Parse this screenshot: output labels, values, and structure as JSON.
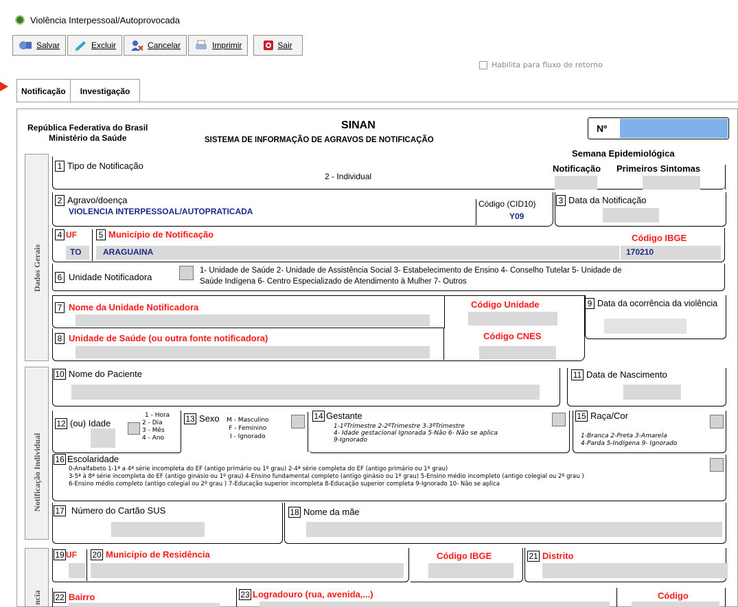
{
  "window": {
    "title": "Violência Interpessoal/Autoprovocada"
  },
  "toolbar": {
    "save": "Salvar",
    "delete": "Excluir",
    "cancel": "Cancelar",
    "print": "Imprimir",
    "exit": "Sair"
  },
  "habilita": "Habilita para fluxo de retorno",
  "tabs": [
    "Notificação",
    "Investigação"
  ],
  "header": {
    "republica": "República Federativa do Brasil",
    "ministerio": "Ministério da Saúde",
    "sinan": "SINAN",
    "sistema": "SISTEMA DE INFORMAÇÃO  DE AGRAVOS DE NOTIFICAÇÃO",
    "numero": "Nº"
  },
  "sections": {
    "gerais": "Dados Gerais",
    "individual": "Notificação Individual",
    "residencia": "ncia"
  },
  "f1": {
    "num": "1",
    "label": "Tipo de Notificação",
    "value": "2 - Individual",
    "semana": "Semana Epidemiológica",
    "notif": "Notificação",
    "sintomas": "Primeiros Sintomas"
  },
  "f2": {
    "num": "2",
    "label": "Agravo/doença",
    "value": "VIOLENCIA INTERPESSOAL/AUTOPRATICADA",
    "cid_label": "Código (CID10)",
    "cid": "Y09"
  },
  "f3": {
    "num": "3",
    "label": "Data da Notificação"
  },
  "f4": {
    "num": "4",
    "label": "UF",
    "value": "TO"
  },
  "f5": {
    "num": "5",
    "label": "Município de Notificação",
    "value": "ARAGUAINA",
    "ibge_label": "Código IBGE",
    "ibge": "170210"
  },
  "f6": {
    "num": "6",
    "label": "Unidade Notificadora",
    "options1": "1- Unidade de Saúde   2- Unidade de Assistência Social  3- Estabelecimento de Ensino  4- Conselho Tutelar  5- Unidade de",
    "options2": "Saúde Indígena  6- Centro Especializado de Atendimento à Mulher  7- Outros"
  },
  "f7": {
    "num": "7",
    "label": "Nome da Unidade Notificadora",
    "cod": "Código Unidade"
  },
  "f8": {
    "num": "8",
    "label": "Unidade de Saúde (ou outra fonte notificadora)",
    "cod": "Código CNES"
  },
  "f9": {
    "num": "9",
    "label": "Data da ocorrência da violência"
  },
  "f10": {
    "num": "10",
    "label": "Nome do Paciente"
  },
  "f11": {
    "num": "11",
    "label": "Data de Nascimento"
  },
  "f12": {
    "num": "12",
    "label": "(ou) Idade",
    "o1": "1 - Hora",
    "o2": "2 - Dia",
    "o3": "3 - Mês",
    "o4": "4 - Ano"
  },
  "f13": {
    "num": "13",
    "label": "Sexo",
    "o1": "M - Masculino",
    "o2": "F - Feminino",
    "o3": "I - Ignorado"
  },
  "f14": {
    "num": "14",
    "label": "Gestante",
    "l1": "1-1ºTrimestre   2-2ºTrimestre        3-3ºTrimestre",
    "l2": "4- Idade gestacional Ignorada   5-Não      6- Não se aplica",
    "l3": "9-Ignorado"
  },
  "f15": {
    "num": "15",
    "label": "Raça/Cor",
    "l1": "1-Branca     2-Preta          3-Amarela",
    "l2": "4-Parda       5-Indígena     9- Ignorado"
  },
  "f16": {
    "num": "16",
    "label": "Escolaridade",
    "l1": "0-Analfabeto    1-1ª a 4ª série incompleta do EF (antigo primário ou 1º grau)    2-4ª série completa do EF (antigo primário ou 1º grau)",
    "l2": "3-5ª à 8ª série incompleta do EF (antigo ginásio ou 1º grau)    4-Ensino fundamental completo (antigo ginásio ou 1º grau)     5-Ensino médio incompleto (antigo colegial  ou 2º grau )",
    "l3": "6-Ensino médio completo (antigo colegial  ou 2º grau )   7-Educação superior incompleta     8-Educação superior completa      9-Ignorado   10- Não se aplica"
  },
  "f17": {
    "num": "17",
    "label": "Número do Cartão SUS"
  },
  "f18": {
    "num": "18",
    "label": "Nome da mãe"
  },
  "f19": {
    "num": "19",
    "label": "UF"
  },
  "f20": {
    "num": "20",
    "label": "Município de Residência",
    "ibge_label": "Código IBGE"
  },
  "f21": {
    "num": "21",
    "label": "Distrito"
  },
  "f22": {
    "num": "22",
    "label": "Bairro"
  },
  "f23": {
    "num": "23",
    "label": "Logradouro (rua, avenida,...)",
    "cod": "Código"
  }
}
